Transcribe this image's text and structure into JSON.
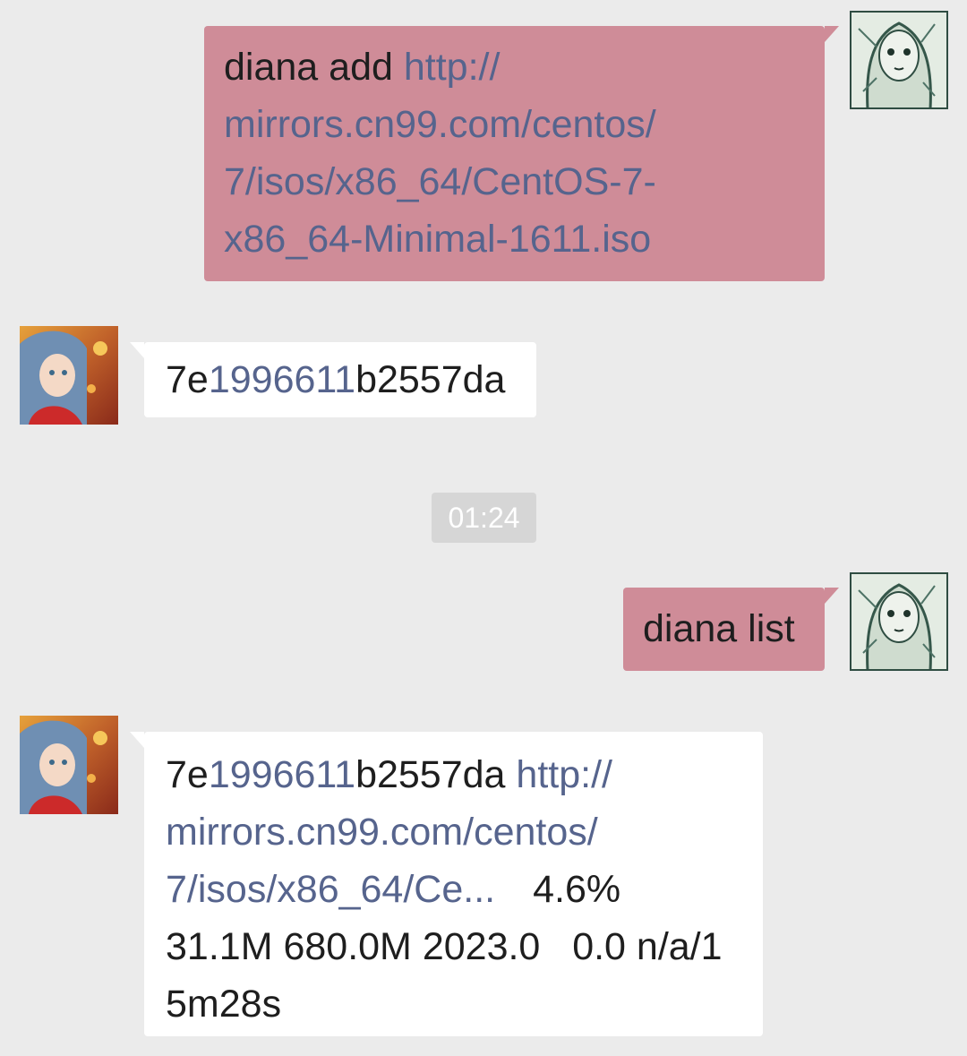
{
  "messages": [
    {
      "sender": "self",
      "text": "diana add",
      "url_lines": [
        "http://",
        "mirrors.cn99.com/centos/",
        "7/isos/x86_64/CentOS-7-",
        "x86_64-Minimal-1611.iso"
      ]
    },
    {
      "sender": "bot",
      "id_prefix": "7e",
      "id_digits": "1996611",
      "id_suffix": "b2557da"
    },
    {
      "sender": "self",
      "text": "diana list"
    },
    {
      "sender": "bot",
      "id_prefix": "7e",
      "id_digits": "1996611",
      "id_suffix": "b2557da",
      "url_lines": [
        "http://",
        "mirrors.cn99.com/centos/",
        "7/isos/x86_64/Ce..."
      ],
      "progress": "4.6%",
      "stats_line": "31.1M 680.0M 2023.0   0.0 n/a/1",
      "eta": "5m28s"
    }
  ],
  "timestamp": "01:24",
  "colors": {
    "background": "#ebebeb",
    "outgoing_bubble": "#cf8c98",
    "incoming_bubble": "#ffffff",
    "link": "#56648d"
  },
  "icons": {
    "self_avatar": "sketch-portrait-avatar",
    "bot_avatar": "anime-girl-avatar"
  }
}
